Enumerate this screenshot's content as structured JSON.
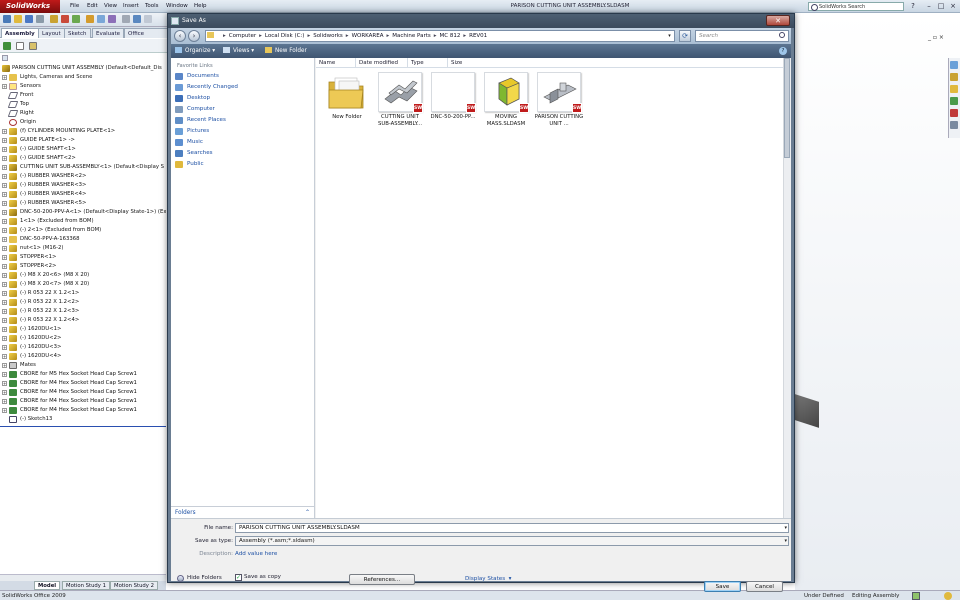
{
  "app": {
    "logo": "SolidWorks",
    "menus": [
      "File",
      "Edit",
      "View",
      "Insert",
      "Tools",
      "Window",
      "Help"
    ],
    "title": "PARISON CUTTING UNIT ASSEMBLY.SLDASM",
    "search_placeholder": "SolidWorks Search",
    "help_glyph": "?",
    "min_glyph": "–",
    "restore_glyph": "□",
    "close_glyph": "×",
    "doc_ctrls": "_ ▫ ×"
  },
  "cm_tabs": [
    "Assembly",
    "Layout",
    "Sketch",
    "Evaluate",
    "Office Produc"
  ],
  "feature_tree": {
    "root": "PARISON CUTTING UNIT ASSEMBLY  (Default<Default_Dis",
    "items": [
      {
        "label": "Lights, Cameras and Scene",
        "icon": "folder",
        "exp": "+"
      },
      {
        "label": "Sensors",
        "icon": "light",
        "exp": "+"
      },
      {
        "label": "Front",
        "icon": "plane",
        "exp": ""
      },
      {
        "label": "Top",
        "icon": "plane",
        "exp": ""
      },
      {
        "label": "Right",
        "icon": "plane",
        "exp": ""
      },
      {
        "label": "Origin",
        "icon": "orig",
        "exp": ""
      },
      {
        "label": "(f) CYLINDER MOUNTING PLATE<1>",
        "icon": "part",
        "exp": "+"
      },
      {
        "label": "GUIDE PLATE<1> ->",
        "icon": "part",
        "exp": "+"
      },
      {
        "label": "(-) GUIDE SHAFT<1>",
        "icon": "part",
        "exp": "+"
      },
      {
        "label": "(-) GUIDE SHAFT<2>",
        "icon": "part",
        "exp": "+"
      },
      {
        "label": "CUTTING UNIT SUB-ASSEMBLY<1> (Default<Display S",
        "icon": "asm",
        "exp": "+"
      },
      {
        "label": "(-) RUBBER WASHER<2>",
        "icon": "part",
        "exp": "+"
      },
      {
        "label": "(-) RUBBER WASHER<3>",
        "icon": "part",
        "exp": "+"
      },
      {
        "label": "(-) RUBBER WASHER<4>",
        "icon": "part",
        "exp": "+"
      },
      {
        "label": "(-) RUBBER WASHER<5>",
        "icon": "part",
        "exp": "+"
      },
      {
        "label": "DNC-50-200-PPV-A<1> (Default<Display State-1>) (Ex",
        "icon": "asm",
        "exp": "+"
      },
      {
        "label": "1<1> (Excluded from BOM)",
        "icon": "part",
        "exp": "+"
      },
      {
        "label": "(-) 2<1> (Excluded from BOM)",
        "icon": "part",
        "exp": "+"
      },
      {
        "label": "DNC-50-PPV-A-163368",
        "icon": "folder",
        "exp": "+"
      },
      {
        "label": "nut<1> (M16-2)",
        "icon": "part",
        "exp": "+"
      },
      {
        "label": "STOPPER<1>",
        "icon": "part",
        "exp": "+"
      },
      {
        "label": "STOPPER<2>",
        "icon": "part",
        "exp": "+"
      },
      {
        "label": "(-) M8 X 20<6> (M8 X 20)",
        "icon": "part",
        "exp": "+"
      },
      {
        "label": "(-) M8 X 20<7> (M8 X 20)",
        "icon": "part",
        "exp": "+"
      },
      {
        "label": "(-) R 053 22 X 1.2<1>",
        "icon": "part",
        "exp": "+"
      },
      {
        "label": "(-) R 053 22 X 1.2<2>",
        "icon": "part",
        "exp": "+"
      },
      {
        "label": "(-) R 053 22 X 1.2<3>",
        "icon": "part",
        "exp": "+"
      },
      {
        "label": "(-) R 053 22 X 1.2<4>",
        "icon": "part",
        "exp": "+"
      },
      {
        "label": "(-) 1620DU<1>",
        "icon": "part",
        "exp": "+"
      },
      {
        "label": "(-) 1620DU<2>",
        "icon": "part",
        "exp": "+"
      },
      {
        "label": "(-) 1620DU<3>",
        "icon": "part",
        "exp": "+"
      },
      {
        "label": "(-) 1620DU<4>",
        "icon": "part",
        "exp": "+"
      },
      {
        "label": "Mates",
        "icon": "mate",
        "exp": "+"
      },
      {
        "label": "CBORE for M5 Hex Socket Head Cap Screw1",
        "icon": "feat",
        "exp": "+"
      },
      {
        "label": "CBORE for M4 Hex Socket Head Cap Screw1",
        "icon": "feat",
        "exp": "+"
      },
      {
        "label": "CBORE for M4 Hex Socket Head Cap Screw1",
        "icon": "feat",
        "exp": "+"
      },
      {
        "label": "CBORE for M4 Hex Socket Head Cap Screw1",
        "icon": "feat",
        "exp": "+"
      },
      {
        "label": "CBORE for M4 Hex Socket Head Cap Screw1",
        "icon": "feat",
        "exp": "+"
      },
      {
        "label": "(-) Sketch13",
        "icon": "sketch",
        "exp": ""
      }
    ]
  },
  "bottom_tabs": [
    "Model",
    "Motion Study 1",
    "Motion Study 2"
  ],
  "status": {
    "left": "SolidWorks Office 2009",
    "under_defined": "Under Defined",
    "editing": "Editing Assembly"
  },
  "dialog": {
    "title": "Save As",
    "close": "✕",
    "breadcrumbs": [
      "Computer",
      "Local Disk (C:)",
      "Solidworks",
      "WORKAREA",
      "Machine Parts",
      "MC 812",
      "REV01"
    ],
    "search_placeholder": "Search",
    "commands": {
      "organize": "Organize",
      "views": "Views",
      "new_folder": "New Folder"
    },
    "fav_heading": "Favorite Links",
    "favorites": [
      {
        "label": "Documents",
        "color": "#5a86c8"
      },
      {
        "label": "Recently Changed",
        "color": "#6b9bd6"
      },
      {
        "label": "Desktop",
        "color": "#3d6fb8"
      },
      {
        "label": "Computer",
        "color": "#7f9bbd"
      },
      {
        "label": "Recent Places",
        "color": "#5f8ec7"
      },
      {
        "label": "Pictures",
        "color": "#6a9fd7"
      },
      {
        "label": "Music",
        "color": "#5d8fd0"
      },
      {
        "label": "Searches",
        "color": "#4d7fc0"
      },
      {
        "label": "Public",
        "color": "#e0b93d"
      }
    ],
    "folders_label": "Folders",
    "columns": [
      "Name",
      "Date modified",
      "Type",
      "Size"
    ],
    "files": [
      {
        "label": "New Folder",
        "kind": "folder"
      },
      {
        "label": "CUTTING UNIT SUB-ASSEMBLY...",
        "kind": "asm"
      },
      {
        "label": "DNC-50-200-PP...",
        "kind": "blank"
      },
      {
        "label": "MOVING MASS.SLDASM",
        "kind": "cube"
      },
      {
        "label": "PARISON CUTTING UNIT ...",
        "kind": "asm2"
      }
    ],
    "badge_text": "SW",
    "file_name_label": "File name:",
    "file_name_value": "PARISON CUTTING UNIT ASSEMBLY.SLDASM",
    "save_type_label": "Save as type:",
    "save_type_value": "Assembly (*.asm;*.sldasm)",
    "description_label": "Description:",
    "description_link": "Add value here",
    "save_copy_label": "Save as copy",
    "references_btn": "References...",
    "display_states": "Display States",
    "save_btn": "Save",
    "cancel_btn": "Cancel",
    "hide_folders": "Hide Folders"
  }
}
